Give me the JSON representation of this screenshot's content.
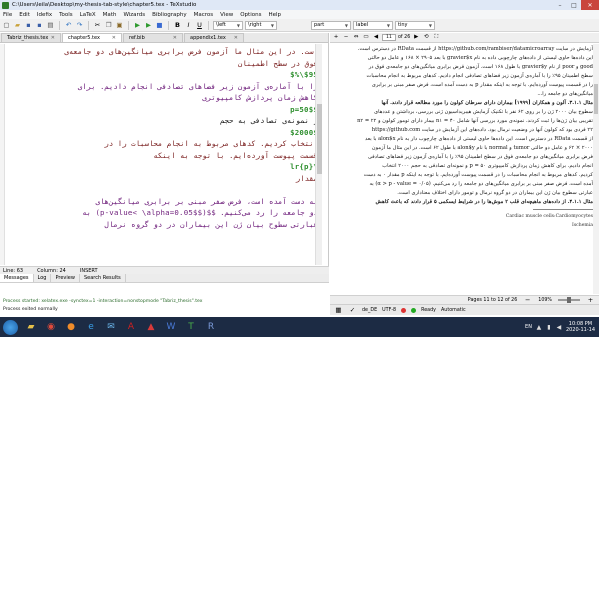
{
  "window": {
    "title": "C:\\Users\\leila\\Desktop\\my-thesis-tab-style\\chapter5.tex - TeXstudio",
    "controls": [
      "–",
      "□",
      "✕"
    ]
  },
  "menu": [
    "File",
    "Edit",
    "Idefix",
    "Tools",
    "LaTeX",
    "Math",
    "Wizards",
    "Bibliography",
    "Macros",
    "View",
    "Options",
    "Help"
  ],
  "toolbar": {
    "icons": [
      "new-file-icon",
      "open-file-icon",
      "save-icon",
      "save-all-icon",
      "print-icon",
      "undo-icon",
      "redo-icon",
      "cut-icon",
      "copy-icon",
      "paste-icon",
      "compile-icon",
      "view-icon",
      "stop-icon",
      "bold-icon",
      "italic-icon",
      "underline-icon"
    ],
    "selects": [
      {
        "value": "\\left"
      },
      {
        "value": "\\right"
      },
      {
        "value": "part"
      },
      {
        "value": "label"
      },
      {
        "value": "tiny"
      }
    ]
  },
  "editor": {
    "tabs": [
      {
        "label": "Tabriz_thesis.tex",
        "active": false
      },
      {
        "label": "chapter5.tex",
        "active": true
      },
      {
        "label": "ref.bib",
        "active": false
      },
      {
        "label": "appendix1.tex",
        "active": false
      }
    ],
    "lines": [
      {
        "text": "است. در این مثال ما آزمون فرض برابری میانگین‌های دو جامعه‌ی",
        "style": "brown"
      },
      {
        "text": "فوق در سطح اطمینان",
        "style": "brown"
      },
      {
        "text": "$95\\%$",
        "style": "green"
      },
      {
        "text": "را با آماره‌ی آزمون زیر فضاهای تصادفی انجام دادیم. برای",
        "style": "purple"
      },
      {
        "text": "کاهش زمان پردازش کامپیوتری",
        "style": "purple"
      },
      {
        "text": "$p=50$",
        "style": "green"
      },
      {
        "text": "و نمونه‌ی تصادفی به حجم",
        "style": "dark"
      },
      {
        "text": "$2000$",
        "style": "green"
      },
      {
        "text": "انتخاب کردیم. کدهای مربوط به انجام محاسبات را در",
        "style": "brown"
      },
      {
        "text": "قسمت پیوست آورده‌ایم. با توجه به اینکه",
        "style": "brown"
      },
      {
        "text": "\\lr{p}",
        "style": "green"
      },
      {
        "text": "مقدار",
        "style": "brown"
      },
      {
        "text": "",
        "style": "blank"
      },
      {
        "text": "به دست آمده است، فرض صفر مبنی بر برابری میانگین‌های",
        "style": "purple"
      },
      {
        "text": "دو جامعه را رد می‌کنیم. $$(p-value< \\alpha=0.05$$) به",
        "style": "purple"
      },
      {
        "text": "عبارتی سطوح بیان ژن این بیماران در دو گروه نرمال",
        "style": "purple"
      }
    ],
    "status": {
      "line": "Line: 63",
      "column": "Column: 24",
      "mode": "INSERT"
    }
  },
  "messages": {
    "tabs": [
      {
        "label": "Messages",
        "active": true
      },
      {
        "label": "Log",
        "active": false
      },
      {
        "label": "Preview",
        "active": false
      },
      {
        "label": "Search Results",
        "active": false
      }
    ],
    "line1": "Process started: xelatex.exe -synctex=1 -interaction=nonstopmode \"Tabriz_thesis\".tex",
    "line2": "Process exited normally"
  },
  "pdf": {
    "page_input": "11",
    "page_of": "of 26",
    "lines": [
      {
        "text": "آزمایش در سایت https://github.com/rambiser/datamicroarray از قسمت RData در دسترس است.",
        "bold": false
      },
      {
        "text": "این داده‌ها حاوی لیستی از داده‌های چارچوبی داده به نام gravier$x با بعد ۲۹۰۵ × ۱۶۸ و عامل دو حالتی",
        "bold": false
      },
      {
        "text": "good و poor از نام gravier$y با طول ۱۶۸ است. آزمون فرض برابری میانگین‌های دو جامعه‌ی فوق در",
        "bold": false
      },
      {
        "text": "سطح اطمینان ۹۵٪ را با آماره‌ی آزمون زیر فضاهای تصادفی انجام دادیم. کدهای مربوط به انجام محاسبات",
        "bold": false
      },
      {
        "text": "را در قسمت پیوست آورده‌ایم. با توجه به اینکه مقدار p به دست آمده است، فرض صفر مبنی بر برابری",
        "bold": false
      },
      {
        "text": "میانگین‌های دو جامعه را...",
        "bold": false
      },
      {
        "text": "",
        "bold": false
      },
      {
        "text": "مثال ۳.۱.۱. آلون و همکاران [۱۹۹۹] بیماران دارای سرطان کولون را مورد مطالعه قرار دادند. آنها",
        "bold": true
      },
      {
        "text": "سطوح بیان ۲۰۰۰ ژن را بر روی ۶۲ نفر با تکنیک آزمایش هیبریداسیون ژنی بررسی، برداشتن و عددهای",
        "bold": false
      },
      {
        "text": "تقریبی بیان ژن‌ها را ثبت کردند. نمونه‌ی مورد بررسی آنها شامل ۴۰ = n۱ بیمار دارای تومور کولون و ۲۲ = n۲",
        "bold": false
      },
      {
        "text": "۲۲ فردی بود که کولون آنها در وضعیت نرمال بود. داده‌های این آزمایش در سایت https://github.com",
        "bold": false
      },
      {
        "text": "از قسمت RData در دسترس است. این داده‌ها حاوی لیستی از داده‌های چارچوب دار به نام alon$x با بعد",
        "bold": false
      },
      {
        "text": "۲۰۰۰ × ۶۲ و عامل دو حالتی tumor و normal با نام alon$y با طول ۶۲ است. در این مثال ما آزمون",
        "bold": false
      },
      {
        "text": "فرض برابری میانگین‌های دو جامعه‌ی فوق در سطح اطمینان ۹۵٪ را با آماره‌ی آزمون زیر فضاهای تصادفی",
        "bold": false
      },
      {
        "text": "انجام دادیم. برای کاهش زمان پردازش کامپیوتری ۵۰ = p و نمونه‌ای تصادفی به حجم ۲۰۰۰ انتخاب",
        "bold": false
      },
      {
        "text": "کردیم. کدهای مربوط به انجام محاسبات را در قسمت پیوست آورده‌ایم. با توجه به اینکه p مقدار ۰ به دست",
        "bold": false
      },
      {
        "text": "آمده است، فرض صفر مبنی بر برابری میانگین‌های دو جامعه را رد می‌کنیم. (۰/۰۵ = α > p - value) به",
        "bold": false
      },
      {
        "text": "عبارتی سطوح بیان ژن این بیماران در دو گروه نرمال و تومور دارای اختلاف معناداری است.",
        "bold": false
      },
      {
        "text": "",
        "bold": false
      },
      {
        "text": "مثال ۴.۱.۱. از داده‌های ماهیچه‌ای قلب ۲ موش‌ها را در شرایط ایسکمی ۵ قرار دادند که باعث کاهش",
        "bold": true
      }
    ],
    "footnotes": [
      "Cardiac muscle cells:Cardiomyocytes",
      "Ischemia"
    ],
    "status_pages": "Pages 11 to 12 of 26",
    "zoom": "109%",
    "statusbar_items": [
      "de_DE",
      "UTF-8",
      "Ready",
      "Automatic"
    ]
  },
  "taskbar": {
    "apps": [
      "start-icon",
      "explorer-icon",
      "chrome-icon",
      "firefox-icon",
      "ie-icon",
      "mail-icon",
      "acrobat-icon",
      "pdf-icon",
      "word-icon",
      "texstudio-icon",
      "r-icon"
    ],
    "lang": "EN",
    "time": "10:08 PM",
    "date": "2020-11-14"
  }
}
